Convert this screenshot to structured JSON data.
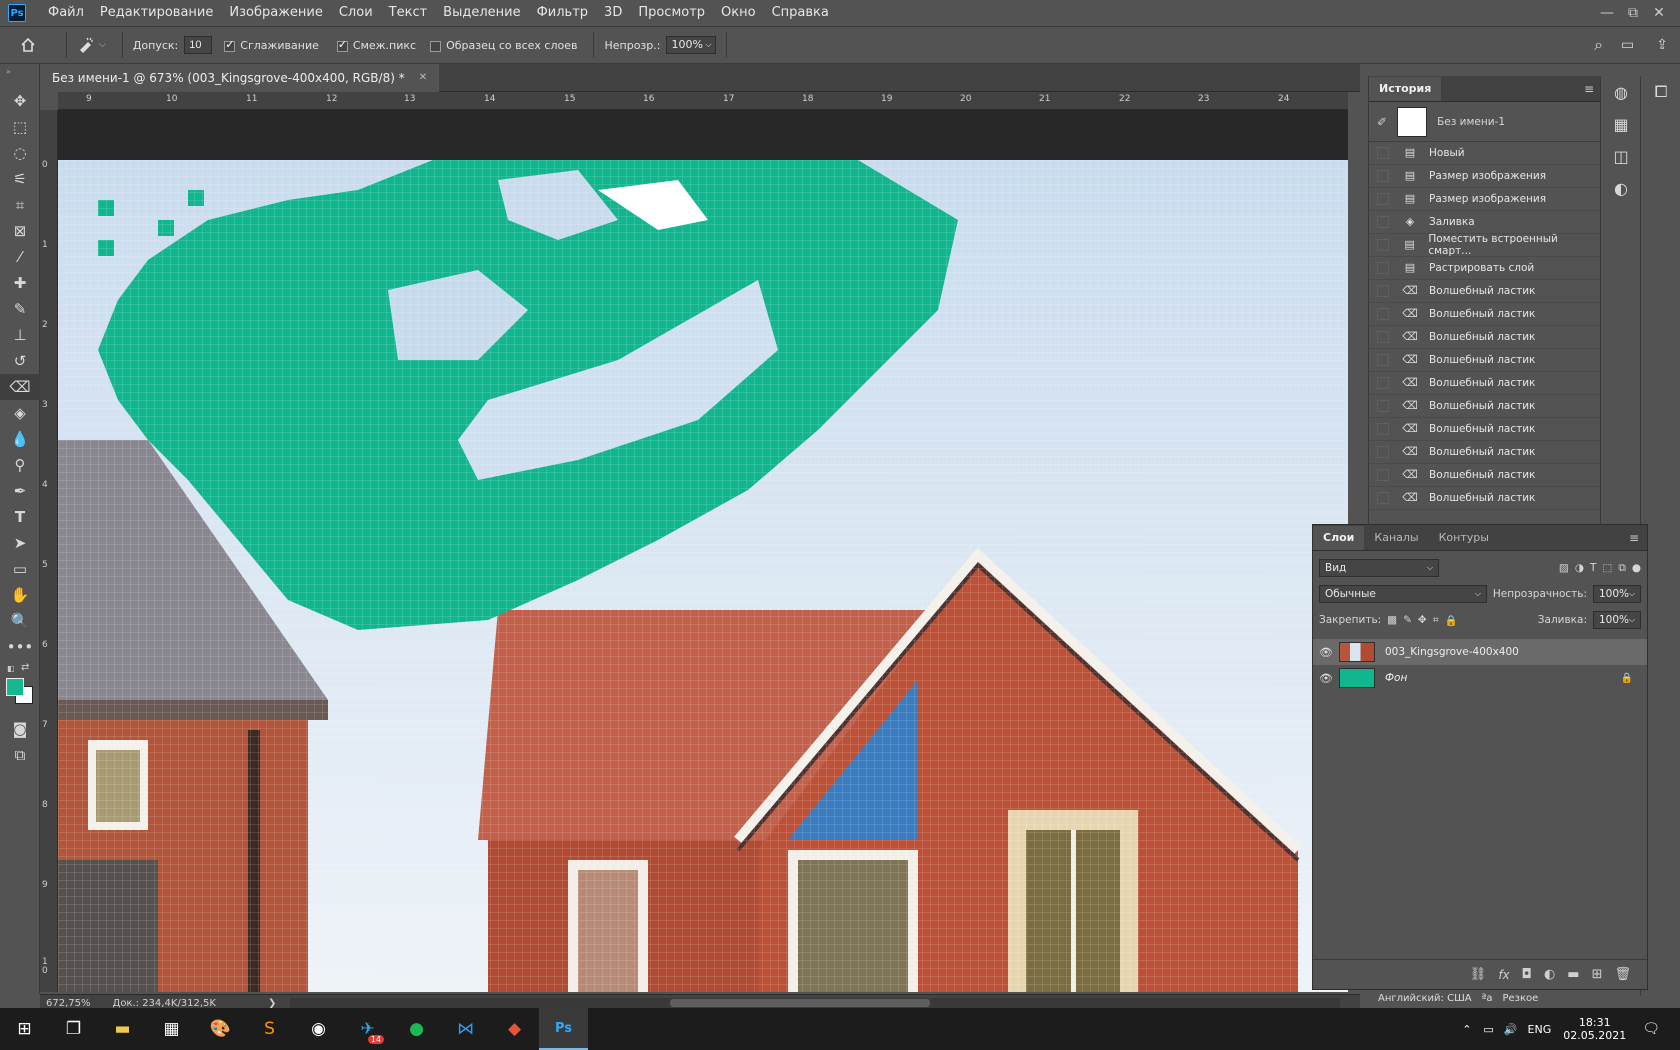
{
  "menubar": {
    "logo": "Ps",
    "items": [
      "Файл",
      "Редактирование",
      "Изображение",
      "Слои",
      "Текст",
      "Выделение",
      "Фильтр",
      "3D",
      "Просмотр",
      "Окно",
      "Справка"
    ],
    "win_min": "—",
    "win_max": "⧉",
    "win_close": "✕"
  },
  "options": {
    "tolerance_label": "Допуск:",
    "tolerance_value": "10",
    "antialias_label": "Сглаживание",
    "contiguous_label": "Смеж.пикс",
    "sample_all_label": "Образец со всех слоев",
    "opacity_label": "Непрозр.:",
    "opacity_value": "100%"
  },
  "document": {
    "tab_title": "Без имени-1 @ 673% (003_Kingsgrove-400x400, RGB/8) *",
    "tab_close": "✕",
    "ruler_top": [
      "9",
      "10",
      "11",
      "12",
      "13",
      "14",
      "15",
      "16",
      "17",
      "18",
      "19",
      "20",
      "21",
      "22",
      "23",
      "24"
    ],
    "ruler_left": [
      "0",
      "1",
      "2",
      "3",
      "4",
      "5",
      "6",
      "7",
      "8",
      "9",
      "1 0"
    ]
  },
  "status": {
    "zoom": "672,75%",
    "doc": "Док.: 234,4K/312,5K",
    "arrow": "❯"
  },
  "history": {
    "tab": "История",
    "snapshot": "Без имени-1",
    "items": [
      "Новый",
      "Размер изображения",
      "Размер изображения",
      "Заливка",
      "Поместить встроенный смарт...",
      "Растрировать слой",
      "Волшебный ластик",
      "Волшебный ластик",
      "Волшебный ластик",
      "Волшебный ластик",
      "Волшебный ластик",
      "Волшебный ластик",
      "Волшебный ластик",
      "Волшебный ластик",
      "Волшебный ластик",
      "Волшебный ластик"
    ]
  },
  "layers": {
    "tabs": [
      "Слои",
      "Каналы",
      "Контуры"
    ],
    "filter": "Вид",
    "blend": "Обычные",
    "opacity_label": "Непрозрачность:",
    "opacity_value": "100%",
    "lock_label": "Закрепить:",
    "fill_label": "Заливка:",
    "fill_value": "100%",
    "rows": [
      {
        "name": "003_Kingsgrove-400x400"
      },
      {
        "name": "Фон"
      }
    ]
  },
  "lang": {
    "input": "Английский: США",
    "aa": "ªа",
    "sharp": "Резкое"
  },
  "taskbar": {
    "lang": "ENG",
    "time": "18:31",
    "date": "02.05.2021",
    "badge": "14"
  },
  "colors": {
    "accent": "#00b48c",
    "fg_swatch": "#16b88e",
    "bg_swatch": "#ffffff"
  }
}
